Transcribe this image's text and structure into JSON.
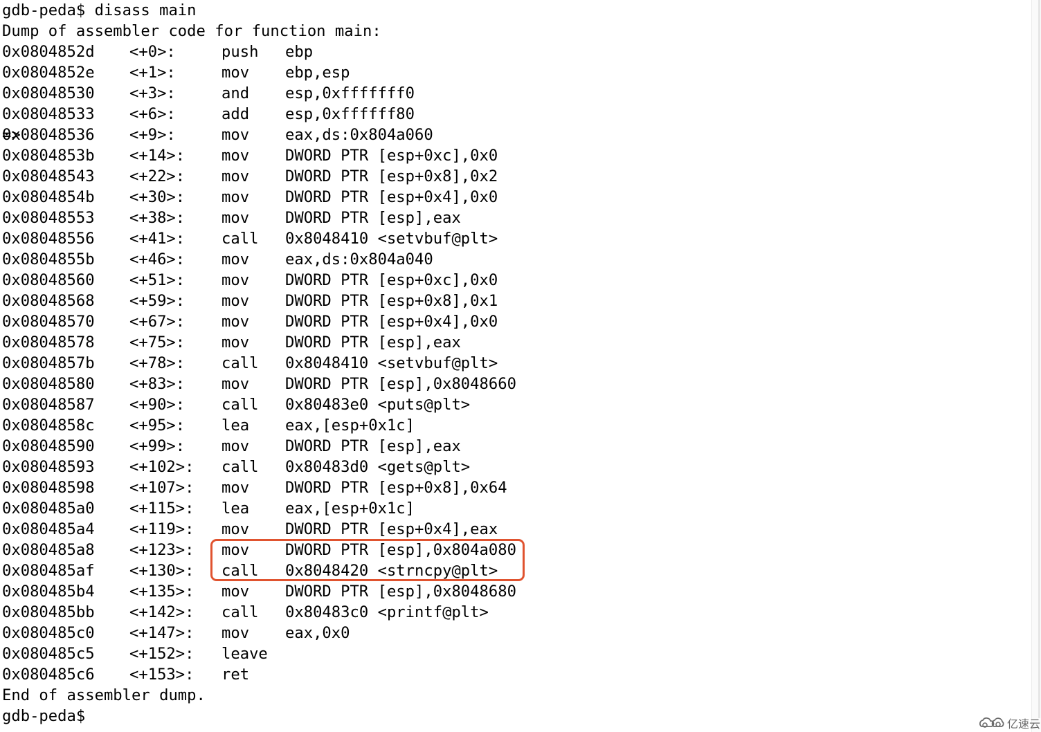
{
  "terminal": {
    "command_line": "gdb-peda$ disass main",
    "header": "Dump of assembler code for function main:",
    "current_marker": "=>",
    "instructions": [
      {
        "marker": "",
        "address": "0x0804852d",
        "offset": "<+0>:",
        "mnemonic": "push",
        "operands": "ebp"
      },
      {
        "marker": "",
        "address": "0x0804852e",
        "offset": "<+1>:",
        "mnemonic": "mov",
        "operands": "ebp,esp"
      },
      {
        "marker": "",
        "address": "0x08048530",
        "offset": "<+3>:",
        "mnemonic": "and",
        "operands": "esp,0xfffffff0"
      },
      {
        "marker": "",
        "address": "0x08048533",
        "offset": "<+6>:",
        "mnemonic": "add",
        "operands": "esp,0xffffff80"
      },
      {
        "marker": "=>",
        "address": "0x08048536",
        "offset": "<+9>:",
        "mnemonic": "mov",
        "operands": "eax,ds:0x804a060"
      },
      {
        "marker": "",
        "address": "0x0804853b",
        "offset": "<+14>:",
        "mnemonic": "mov",
        "operands": "DWORD PTR [esp+0xc],0x0"
      },
      {
        "marker": "",
        "address": "0x08048543",
        "offset": "<+22>:",
        "mnemonic": "mov",
        "operands": "DWORD PTR [esp+0x8],0x2"
      },
      {
        "marker": "",
        "address": "0x0804854b",
        "offset": "<+30>:",
        "mnemonic": "mov",
        "operands": "DWORD PTR [esp+0x4],0x0"
      },
      {
        "marker": "",
        "address": "0x08048553",
        "offset": "<+38>:",
        "mnemonic": "mov",
        "operands": "DWORD PTR [esp],eax"
      },
      {
        "marker": "",
        "address": "0x08048556",
        "offset": "<+41>:",
        "mnemonic": "call",
        "operands": "0x8048410 <setvbuf@plt>"
      },
      {
        "marker": "",
        "address": "0x0804855b",
        "offset": "<+46>:",
        "mnemonic": "mov",
        "operands": "eax,ds:0x804a040"
      },
      {
        "marker": "",
        "address": "0x08048560",
        "offset": "<+51>:",
        "mnemonic": "mov",
        "operands": "DWORD PTR [esp+0xc],0x0"
      },
      {
        "marker": "",
        "address": "0x08048568",
        "offset": "<+59>:",
        "mnemonic": "mov",
        "operands": "DWORD PTR [esp+0x8],0x1"
      },
      {
        "marker": "",
        "address": "0x08048570",
        "offset": "<+67>:",
        "mnemonic": "mov",
        "operands": "DWORD PTR [esp+0x4],0x0"
      },
      {
        "marker": "",
        "address": "0x08048578",
        "offset": "<+75>:",
        "mnemonic": "mov",
        "operands": "DWORD PTR [esp],eax"
      },
      {
        "marker": "",
        "address": "0x0804857b",
        "offset": "<+78>:",
        "mnemonic": "call",
        "operands": "0x8048410 <setvbuf@plt>"
      },
      {
        "marker": "",
        "address": "0x08048580",
        "offset": "<+83>:",
        "mnemonic": "mov",
        "operands": "DWORD PTR [esp],0x8048660"
      },
      {
        "marker": "",
        "address": "0x08048587",
        "offset": "<+90>:",
        "mnemonic": "call",
        "operands": "0x80483e0 <puts@plt>"
      },
      {
        "marker": "",
        "address": "0x0804858c",
        "offset": "<+95>:",
        "mnemonic": "lea",
        "operands": "eax,[esp+0x1c]"
      },
      {
        "marker": "",
        "address": "0x08048590",
        "offset": "<+99>:",
        "mnemonic": "mov",
        "operands": "DWORD PTR [esp],eax"
      },
      {
        "marker": "",
        "address": "0x08048593",
        "offset": "<+102>:",
        "mnemonic": "call",
        "operands": "0x80483d0 <gets@plt>"
      },
      {
        "marker": "",
        "address": "0x08048598",
        "offset": "<+107>:",
        "mnemonic": "mov",
        "operands": "DWORD PTR [esp+0x8],0x64"
      },
      {
        "marker": "",
        "address": "0x080485a0",
        "offset": "<+115>:",
        "mnemonic": "lea",
        "operands": "eax,[esp+0x1c]"
      },
      {
        "marker": "",
        "address": "0x080485a4",
        "offset": "<+119>:",
        "mnemonic": "mov",
        "operands": "DWORD PTR [esp+0x4],eax"
      },
      {
        "marker": "",
        "address": "0x080485a8",
        "offset": "<+123>:",
        "mnemonic": "mov",
        "operands": "DWORD PTR [esp],0x804a080"
      },
      {
        "marker": "",
        "address": "0x080485af",
        "offset": "<+130>:",
        "mnemonic": "call",
        "operands": "0x8048420 <strncpy@plt>"
      },
      {
        "marker": "",
        "address": "0x080485b4",
        "offset": "<+135>:",
        "mnemonic": "mov",
        "operands": "DWORD PTR [esp],0x8048680"
      },
      {
        "marker": "",
        "address": "0x080485bb",
        "offset": "<+142>:",
        "mnemonic": "call",
        "operands": "0x80483c0 <printf@plt>"
      },
      {
        "marker": "",
        "address": "0x080485c0",
        "offset": "<+147>:",
        "mnemonic": "mov",
        "operands": "eax,0x0"
      },
      {
        "marker": "",
        "address": "0x080485c5",
        "offset": "<+152>:",
        "mnemonic": "leave",
        "operands": ""
      },
      {
        "marker": "",
        "address": "0x080485c6",
        "offset": "<+153>:",
        "mnemonic": "ret",
        "operands": ""
      }
    ],
    "highlighted_rows": [
      24,
      25
    ],
    "footer": "End of assembler dump.",
    "prompt": "gdb-peda$ "
  },
  "annotation": {
    "highlight_color": "#e0532f"
  },
  "watermark": {
    "icon": "cloud-logo-icon",
    "text": "亿速云"
  }
}
